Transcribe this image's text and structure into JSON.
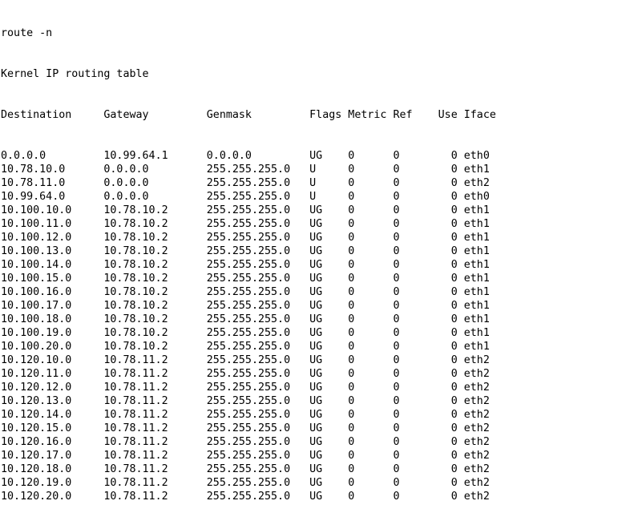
{
  "terminal": {
    "command": "route -n",
    "title": "Kernel IP routing table",
    "header": "Destination     Gateway         Genmask         Flags Metric Ref    Use Iface",
    "columns": [
      "Destination",
      "Gateway",
      "Genmask",
      "Flags",
      "Metric",
      "Ref",
      "Use",
      "Iface"
    ],
    "rows": [
      [
        "0.0.0.0",
        "10.99.64.1",
        "0.0.0.0",
        "UG",
        "0",
        "0",
        "0",
        "eth0"
      ],
      [
        "10.78.10.0",
        "0.0.0.0",
        "255.255.255.0",
        "U",
        "0",
        "0",
        "0",
        "eth1"
      ],
      [
        "10.78.11.0",
        "0.0.0.0",
        "255.255.255.0",
        "U",
        "0",
        "0",
        "0",
        "eth2"
      ],
      [
        "10.99.64.0",
        "0.0.0.0",
        "255.255.255.0",
        "U",
        "0",
        "0",
        "0",
        "eth0"
      ],
      [
        "10.100.10.0",
        "10.78.10.2",
        "255.255.255.0",
        "UG",
        "0",
        "0",
        "0",
        "eth1"
      ],
      [
        "10.100.11.0",
        "10.78.10.2",
        "255.255.255.0",
        "UG",
        "0",
        "0",
        "0",
        "eth1"
      ],
      [
        "10.100.12.0",
        "10.78.10.2",
        "255.255.255.0",
        "UG",
        "0",
        "0",
        "0",
        "eth1"
      ],
      [
        "10.100.13.0",
        "10.78.10.2",
        "255.255.255.0",
        "UG",
        "0",
        "0",
        "0",
        "eth1"
      ],
      [
        "10.100.14.0",
        "10.78.10.2",
        "255.255.255.0",
        "UG",
        "0",
        "0",
        "0",
        "eth1"
      ],
      [
        "10.100.15.0",
        "10.78.10.2",
        "255.255.255.0",
        "UG",
        "0",
        "0",
        "0",
        "eth1"
      ],
      [
        "10.100.16.0",
        "10.78.10.2",
        "255.255.255.0",
        "UG",
        "0",
        "0",
        "0",
        "eth1"
      ],
      [
        "10.100.17.0",
        "10.78.10.2",
        "255.255.255.0",
        "UG",
        "0",
        "0",
        "0",
        "eth1"
      ],
      [
        "10.100.18.0",
        "10.78.10.2",
        "255.255.255.0",
        "UG",
        "0",
        "0",
        "0",
        "eth1"
      ],
      [
        "10.100.19.0",
        "10.78.10.2",
        "255.255.255.0",
        "UG",
        "0",
        "0",
        "0",
        "eth1"
      ],
      [
        "10.100.20.0",
        "10.78.10.2",
        "255.255.255.0",
        "UG",
        "0",
        "0",
        "0",
        "eth1"
      ],
      [
        "10.120.10.0",
        "10.78.11.2",
        "255.255.255.0",
        "UG",
        "0",
        "0",
        "0",
        "eth2"
      ],
      [
        "10.120.11.0",
        "10.78.11.2",
        "255.255.255.0",
        "UG",
        "0",
        "0",
        "0",
        "eth2"
      ],
      [
        "10.120.12.0",
        "10.78.11.2",
        "255.255.255.0",
        "UG",
        "0",
        "0",
        "0",
        "eth2"
      ],
      [
        "10.120.13.0",
        "10.78.11.2",
        "255.255.255.0",
        "UG",
        "0",
        "0",
        "0",
        "eth2"
      ],
      [
        "10.120.14.0",
        "10.78.11.2",
        "255.255.255.0",
        "UG",
        "0",
        "0",
        "0",
        "eth2"
      ],
      [
        "10.120.15.0",
        "10.78.11.2",
        "255.255.255.0",
        "UG",
        "0",
        "0",
        "0",
        "eth2"
      ],
      [
        "10.120.16.0",
        "10.78.11.2",
        "255.255.255.0",
        "UG",
        "0",
        "0",
        "0",
        "eth2"
      ],
      [
        "10.120.17.0",
        "10.78.11.2",
        "255.255.255.0",
        "UG",
        "0",
        "0",
        "0",
        "eth2"
      ],
      [
        "10.120.18.0",
        "10.78.11.2",
        "255.255.255.0",
        "UG",
        "0",
        "0",
        "0",
        "eth2"
      ],
      [
        "10.120.19.0",
        "10.78.11.2",
        "255.255.255.0",
        "UG",
        "0",
        "0",
        "0",
        "eth2"
      ],
      [
        "10.120.20.0",
        "10.78.11.2",
        "255.255.255.0",
        "UG",
        "0",
        "0",
        "0",
        "eth2"
      ]
    ]
  }
}
